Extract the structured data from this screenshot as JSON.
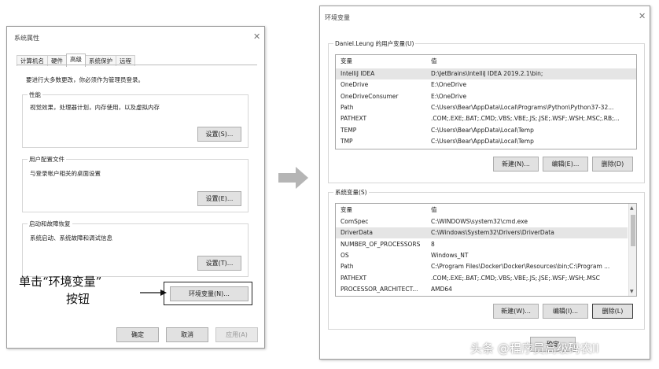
{
  "sysprops": {
    "title": "系统属性",
    "tabs": [
      {
        "label": "计算机名",
        "active": false
      },
      {
        "label": "硬件",
        "active": false
      },
      {
        "label": "高级",
        "active": true
      },
      {
        "label": "系统保护",
        "active": false
      },
      {
        "label": "远程",
        "active": false
      }
    ],
    "admin_note": "要进行大多数更改，你必须作为管理员登录。",
    "performance": {
      "title": "性能",
      "desc": "视觉效果，处理器计划，内存使用，以及虚拟内存",
      "button": "设置(S)..."
    },
    "profiles": {
      "title": "用户配置文件",
      "desc": "与登录帐户相关的桌面设置",
      "button": "设置(E)..."
    },
    "startup": {
      "title": "启动和故障恢复",
      "desc": "系统启动、系统故障和调试信息",
      "button": "设置(T)..."
    },
    "env_button": "环境变量(N)...",
    "ok": "确定",
    "cancel": "取消",
    "apply": "应用(A)"
  },
  "annotation": {
    "line1": "单击“环境变量”",
    "line2": "按钮"
  },
  "envvars": {
    "title": "环境变量",
    "user_group_title": "Daniel.Leung 的用户变量(U)",
    "col_var": "变量",
    "col_val": "值",
    "user_vars": [
      {
        "name": "IntelliJ IDEA",
        "value": "D:\\JetBrains\\IntelliJ IDEA 2019.2.1\\bin;",
        "selected": true
      },
      {
        "name": "OneDrive",
        "value": "E:\\OneDrive",
        "selected": false
      },
      {
        "name": "OneDriveConsumer",
        "value": "E:\\OneDrive",
        "selected": false
      },
      {
        "name": "Path",
        "value": "C:\\Users\\Bear\\AppData\\Local\\Programs\\Python\\Python37-32...",
        "selected": false
      },
      {
        "name": "PATHEXT",
        "value": ".COM;.EXE;.BAT;.CMD;.VBS;.VBE;.JS;.JSE;.WSF;.WSH;.MSC;.RB;...",
        "selected": false
      },
      {
        "name": "TEMP",
        "value": "C:\\Users\\Bear\\AppData\\Local\\Temp",
        "selected": false
      },
      {
        "name": "TMP",
        "value": "C:\\Users\\Bear\\AppData\\Local\\Temp",
        "selected": false
      }
    ],
    "user_buttons": {
      "new": "新建(N)...",
      "edit": "编辑(E)...",
      "delete": "删除(D)"
    },
    "sys_group_title": "系统变量(S)",
    "sys_vars": [
      {
        "name": "ComSpec",
        "value": "C:\\WINDOWS\\system32\\cmd.exe",
        "selected": false
      },
      {
        "name": "DriverData",
        "value": "C:\\Windows\\System32\\Drivers\\DriverData",
        "selected": true
      },
      {
        "name": "NUMBER_OF_PROCESSORS",
        "value": "8",
        "selected": false
      },
      {
        "name": "OS",
        "value": "Windows_NT",
        "selected": false
      },
      {
        "name": "Path",
        "value": "C:\\Program Files\\Docker\\Docker\\Resources\\bin;C:\\Program ...",
        "selected": false
      },
      {
        "name": "PATHEXT",
        "value": ".COM;.EXE;.BAT;.CMD;.VBS;.VBE;.JS;.JSE;.WSF;.WSH;.MSC",
        "selected": false
      },
      {
        "name": "PROCESSOR_ARCHITECT...",
        "value": "AMD64",
        "selected": false
      }
    ],
    "sys_buttons": {
      "new": "新建(W)...",
      "edit": "编辑(I)...",
      "delete": "删除(L)"
    },
    "ok_partial": "确定"
  },
  "watermark": "头条 @程序员高级码农II"
}
